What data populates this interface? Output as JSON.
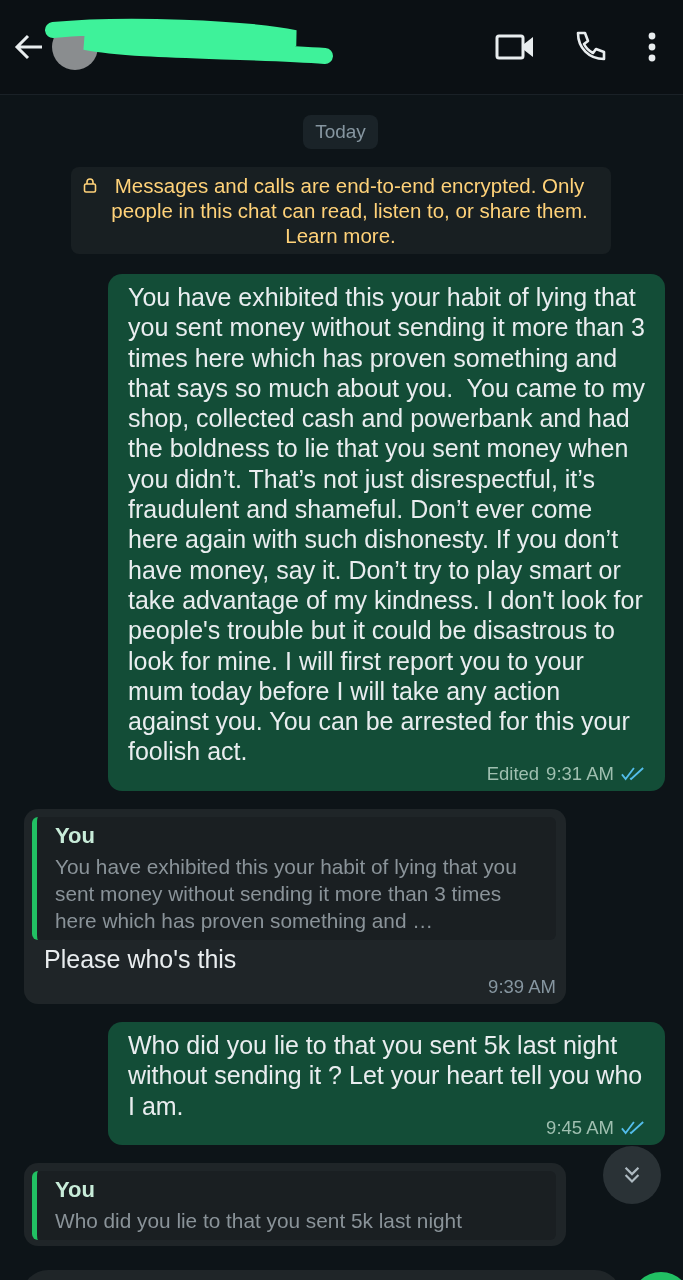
{
  "header": {
    "name_redacted": true
  },
  "date_chip": "Today",
  "encryption_notice": {
    "text": "Messages and calls are end-to-end encrypted. Only people in this chat can read, listen to, or share them.",
    "link": "Learn more."
  },
  "messages": [
    {
      "kind": "outgoing",
      "text": "You have exhibited this your habit of lying that you sent money without sending it more than 3 times here which has proven something and that says so much about you.  You came to my shop, collected cash and powerbank and had the boldness to lie that you sent money when you didn’t. That’s not just disrespectful, it’s fraudulent and shameful. Don’t ever come here again with such dishonesty. If you don’t have money, say it. Don’t try to play smart or take advantage of my kindness. I don't look for people's trouble but it could be disastrous to look for mine. I will first report you to your mum today before I will take any action against you. You can be arrested for this your foolish act.",
      "edited": "Edited",
      "time": "9:31 AM",
      "read": true
    },
    {
      "kind": "incoming",
      "quote": {
        "author": "You",
        "text": "You have exhibited this your habit of lying that you sent money without sending it more than 3 times here which has proven something and …"
      },
      "text": "Please who's this",
      "time": "9:39 AM"
    },
    {
      "kind": "outgoing",
      "text": "Who did you lie to that you sent 5k last night without sending it ? Let your heart tell you who I am.",
      "time": "9:45 AM",
      "read": true
    },
    {
      "kind": "incoming",
      "quote": {
        "author": "You",
        "text": "Who did you lie to that you sent 5k last night"
      }
    }
  ]
}
